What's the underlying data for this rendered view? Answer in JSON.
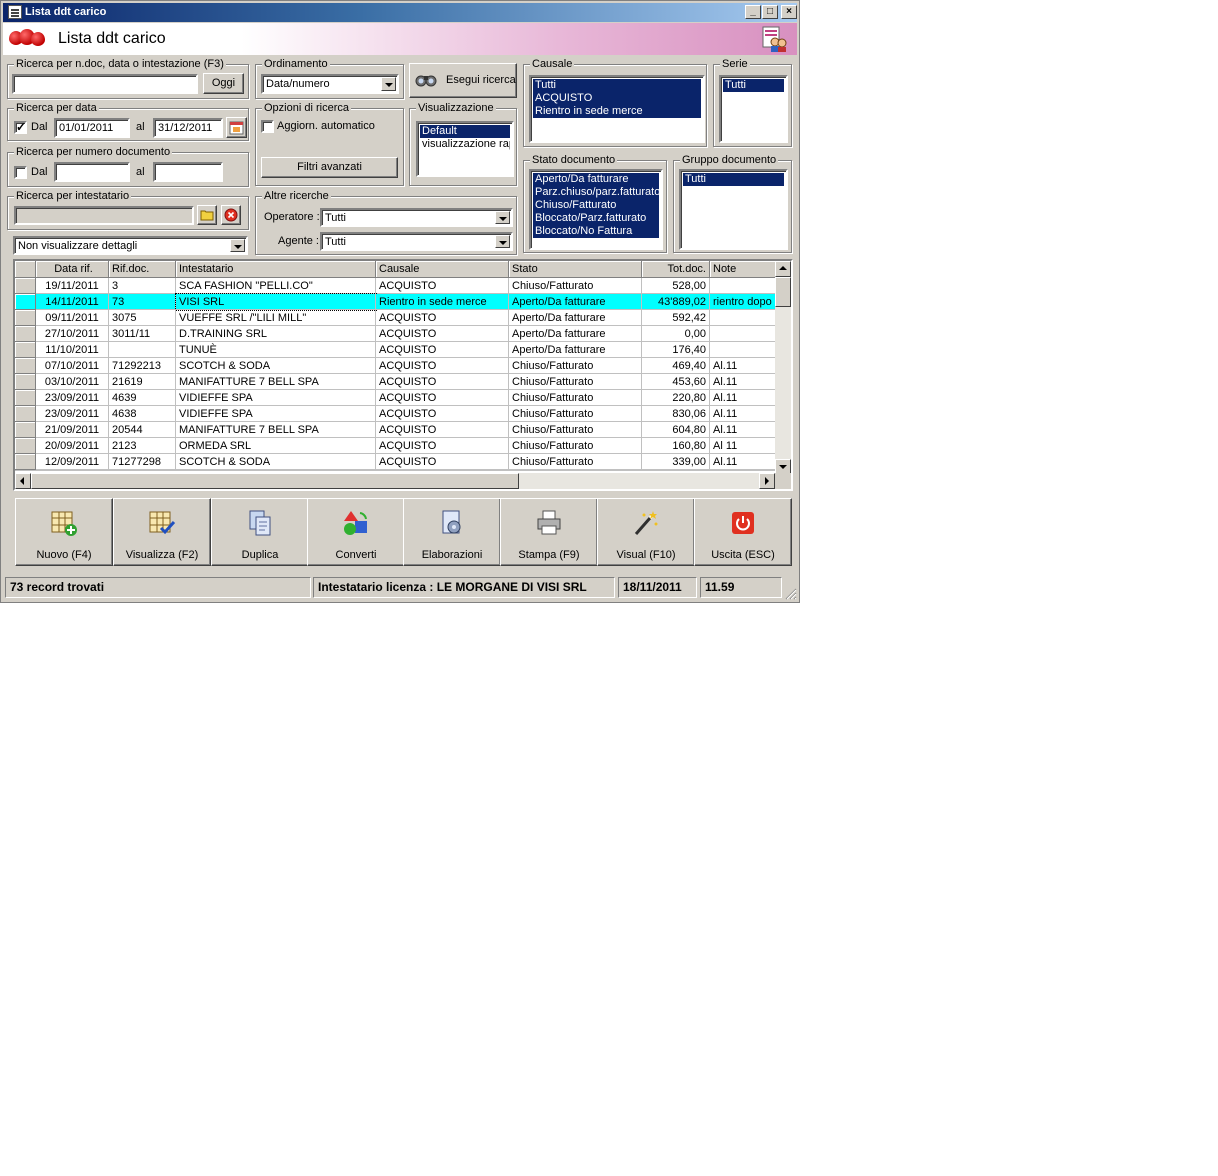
{
  "window": {
    "title": "Lista ddt carico",
    "header_title": "Lista ddt carico"
  },
  "search": {
    "ndoc_group": "Ricerca per n.doc, data o intestazione (F3)",
    "ndoc_value": "",
    "oggi_button": "Oggi",
    "ordinamento_group": "Ordinamento",
    "ordinamento_value": "Data/numero",
    "esegui_button": "Esegui ricerca",
    "data_group": "Ricerca per data",
    "dal_label": "Dal",
    "al_label": "al",
    "date_from": "01/01/2011",
    "date_to": "31/12/2011",
    "numdoc_group": "Ricerca per numero documento",
    "numdoc_dal_label": "Dal",
    "numdoc_al_label": "al",
    "opzioni_group": "Opzioni di ricerca",
    "aggiorn_label": "Aggiorn. automatico",
    "filtri_button": "Filtri avanzati",
    "visualizzazione_group": "Visualizzazione",
    "visualizzazione_items": [
      "Default",
      "visualizzazione rapida"
    ],
    "intestatario_group": "Ricerca per intestatario",
    "intestatario_value": "",
    "dettagli_value": "Non visualizzare dettagli",
    "altre_group": "Altre ricerche",
    "operatore_label": "Operatore :",
    "operatore_value": "Tutti",
    "agente_label": "Agente :",
    "agente_value": "Tutti",
    "causale_group": "Causale",
    "causale_items": [
      "Tutti",
      "ACQUISTO",
      "Rientro in sede merce"
    ],
    "serie_group": "Serie",
    "serie_items": [
      "Tutti"
    ],
    "stato_group": "Stato documento",
    "stato_items": [
      "Aperto/Da fatturare",
      "Parz.chiuso/parz.fatturato",
      "Chiuso/Fatturato",
      "Bloccato/Parz.fatturato",
      "Bloccato/No Fattura"
    ],
    "gruppo_group": "Gruppo documento",
    "gruppo_items": [
      "Tutti"
    ]
  },
  "grid": {
    "columns": [
      "Data rif.",
      "Rif.doc.",
      "Intestatario",
      "Causale",
      "Stato",
      "Tot.doc.",
      "Note"
    ],
    "rows": [
      [
        "19/11/2011",
        "3",
        "SCA FASHION \"PELLI.CO\"",
        "ACQUISTO",
        "Chiuso/Fatturato",
        "528,00",
        ""
      ],
      [
        "14/11/2011",
        "73",
        "VISI SRL",
        "Rientro in sede merce",
        "Aperto/Da fatturare",
        "43'889,02",
        "rientro dopo e"
      ],
      [
        "09/11/2011",
        "3075",
        "VUEFFE SRL /\"LILI MILL\"",
        "ACQUISTO",
        "Aperto/Da fatturare",
        "592,42",
        ""
      ],
      [
        "27/10/2011",
        "3011/11",
        "D.TRAINING SRL",
        "ACQUISTO",
        "Aperto/Da fatturare",
        "0,00",
        ""
      ],
      [
        "11/10/2011",
        "",
        "TUNUÈ",
        "ACQUISTO",
        "Aperto/Da fatturare",
        "176,40",
        ""
      ],
      [
        "07/10/2011",
        "71292213",
        "SCOTCH & SODA",
        "ACQUISTO",
        "Chiuso/Fatturato",
        "469,40",
        "Al.11"
      ],
      [
        "03/10/2011",
        "21619",
        "MANIFATTURE 7 BELL SPA",
        "ACQUISTO",
        "Chiuso/Fatturato",
        "453,60",
        "Al.11"
      ],
      [
        "23/09/2011",
        "4639",
        "VIDIEFFE SPA",
        "ACQUISTO",
        "Chiuso/Fatturato",
        "220,80",
        "Al.11"
      ],
      [
        "23/09/2011",
        "4638",
        "VIDIEFFE SPA",
        "ACQUISTO",
        "Chiuso/Fatturato",
        "830,06",
        "Al.11"
      ],
      [
        "21/09/2011",
        "20544",
        "MANIFATTURE 7 BELL SPA",
        "ACQUISTO",
        "Chiuso/Fatturato",
        "604,80",
        "Al.11"
      ],
      [
        "20/09/2011",
        "2123",
        "ORMEDA SRL",
        "ACQUISTO",
        "Chiuso/Fatturato",
        "160,80",
        "Al 11"
      ],
      [
        "12/09/2011",
        "71277298",
        "SCOTCH & SODA",
        "ACQUISTO",
        "Chiuso/Fatturato",
        "339,00",
        "Al.11"
      ]
    ],
    "selected_row": 1
  },
  "toolbar": {
    "buttons": [
      "Nuovo (F4)",
      "Visualizza (F2)",
      "Duplica",
      "Converti",
      "Elaborazioni",
      "Stampa (F9)",
      "Visual (F10)",
      "Uscita (ESC)"
    ]
  },
  "status": {
    "records": "73 record trovati",
    "license": "Intestatario licenza : LE MORGANE DI VISI SRL",
    "date": "18/11/2011",
    "time": "11.59"
  },
  "colors": {
    "selection": "#0a246a",
    "row_highlight": "#00ffff",
    "face": "#d4d0c8"
  }
}
